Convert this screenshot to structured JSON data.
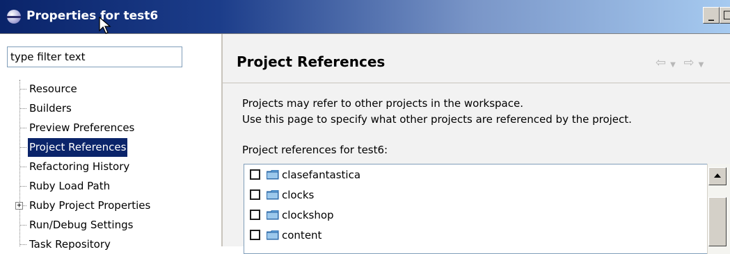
{
  "window": {
    "title": "Properties for test6",
    "controls": [
      "_",
      "□",
      "×"
    ]
  },
  "filter": {
    "value": "type filter text"
  },
  "tree": {
    "items": [
      {
        "label": "Resource",
        "selected": false,
        "expandable": false
      },
      {
        "label": "Builders",
        "selected": false,
        "expandable": false
      },
      {
        "label": "Preview Preferences",
        "selected": false,
        "expandable": false
      },
      {
        "label": "Project References",
        "selected": true,
        "expandable": false
      },
      {
        "label": "Refactoring History",
        "selected": false,
        "expandable": false
      },
      {
        "label": "Ruby Load Path",
        "selected": false,
        "expandable": false
      },
      {
        "label": "Ruby Project Properties",
        "selected": false,
        "expandable": true
      },
      {
        "label": "Run/Debug Settings",
        "selected": false,
        "expandable": false
      },
      {
        "label": "Task Repository",
        "selected": false,
        "expandable": false
      }
    ]
  },
  "page": {
    "title": "Project References",
    "description": [
      "Projects may refer to other projects in the workspace.",
      "Use this page to specify what other projects are referenced by the project."
    ],
    "references_label": "Project references for test6:",
    "projects": [
      {
        "name": "clasefantastica",
        "checked": false
      },
      {
        "name": "clocks",
        "checked": false
      },
      {
        "name": "clockshop",
        "checked": false
      },
      {
        "name": "content",
        "checked": false
      }
    ]
  },
  "icons": {
    "app": "eclipse-icon",
    "back": "back-arrow-icon",
    "forward": "forward-arrow-icon",
    "folder": "folder-icon"
  },
  "colors": {
    "title_bar_start": "#0a246a",
    "selection": "#0a246a",
    "folder": "#5a9bd5"
  }
}
